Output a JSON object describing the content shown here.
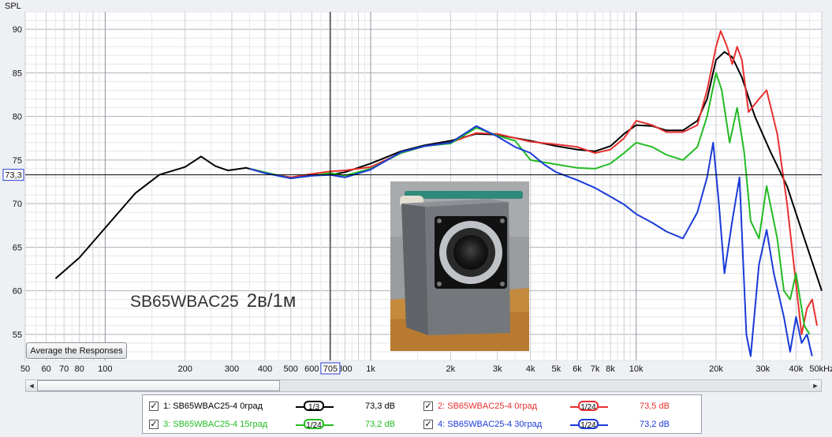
{
  "chart_data": {
    "type": "line",
    "yaxis_title": "SPL",
    "xscale": "log",
    "xlim": [
      50,
      50000
    ],
    "ylim": [
      52,
      92
    ],
    "x_ticks": [
      {
        "v": 50,
        "l": "50"
      },
      {
        "v": 60,
        "l": "60"
      },
      {
        "v": 70,
        "l": "70"
      },
      {
        "v": 80,
        "l": "80"
      },
      {
        "v": 100,
        "l": "100"
      },
      {
        "v": 200,
        "l": "200"
      },
      {
        "v": 300,
        "l": "300"
      },
      {
        "v": 400,
        "l": "400"
      },
      {
        "v": 500,
        "l": "500"
      },
      {
        "v": 600,
        "l": "600"
      },
      {
        "v": 800,
        "l": "800"
      },
      {
        "v": 1000,
        "l": "1k"
      },
      {
        "v": 2000,
        "l": "2k"
      },
      {
        "v": 3000,
        "l": "3k"
      },
      {
        "v": 4000,
        "l": "4k"
      },
      {
        "v": 5000,
        "l": "5k"
      },
      {
        "v": 6000,
        "l": "6k"
      },
      {
        "v": 7000,
        "l": "7k"
      },
      {
        "v": 8000,
        "l": "8k"
      },
      {
        "v": 10000,
        "l": "10k"
      },
      {
        "v": 20000,
        "l": "20k"
      },
      {
        "v": 30000,
        "l": "30k"
      },
      {
        "v": 40000,
        "l": "40k"
      },
      {
        "v": 50000,
        "l": "50kHz"
      }
    ],
    "y_ticks": [
      55,
      60,
      65,
      70,
      75,
      80,
      85,
      90
    ],
    "cursor": {
      "x": 705,
      "y": 73.3,
      "x_label": "705",
      "y_label": "73,3"
    },
    "grid": true,
    "series": [
      {
        "name": "1: SB65WBAC25-4 0град",
        "color": "#000000",
        "points": [
          [
            65,
            61.4
          ],
          [
            80,
            63.8
          ],
          [
            100,
            67.2
          ],
          [
            130,
            71.2
          ],
          [
            160,
            73.3
          ],
          [
            200,
            74.2
          ],
          [
            230,
            75.4
          ],
          [
            260,
            74.3
          ],
          [
            290,
            73.8
          ],
          [
            340,
            74.1
          ],
          [
            400,
            73.5
          ],
          [
            500,
            73.0
          ],
          [
            600,
            73.3
          ],
          [
            705,
            73.3
          ],
          [
            800,
            73.6
          ],
          [
            1000,
            74.6
          ],
          [
            1300,
            76.0
          ],
          [
            1600,
            76.7
          ],
          [
            2000,
            77.2
          ],
          [
            2500,
            78.0
          ],
          [
            3000,
            77.9
          ],
          [
            4000,
            77.2
          ],
          [
            5000,
            76.6
          ],
          [
            6000,
            76.2
          ],
          [
            7000,
            76.0
          ],
          [
            8000,
            76.6
          ],
          [
            9000,
            78.0
          ],
          [
            10000,
            79.0
          ],
          [
            11500,
            78.9
          ],
          [
            13000,
            78.4
          ],
          [
            15000,
            78.4
          ],
          [
            17000,
            79.5
          ],
          [
            18500,
            82.0
          ],
          [
            20000,
            86.5
          ],
          [
            21500,
            87.4
          ],
          [
            23000,
            86.8
          ],
          [
            25000,
            84.5
          ],
          [
            28000,
            80.0
          ],
          [
            32000,
            76.0
          ],
          [
            37000,
            72.0
          ],
          [
            43000,
            66.0
          ],
          [
            50000,
            60.0
          ]
        ]
      },
      {
        "name": "2: SB65WBAC25-4 0град",
        "color": "#e8302f",
        "points": [
          [
            350,
            74.0
          ],
          [
            400,
            73.5
          ],
          [
            500,
            73.0
          ],
          [
            600,
            73.4
          ],
          [
            705,
            73.7
          ],
          [
            800,
            73.8
          ],
          [
            1000,
            74.2
          ],
          [
            1300,
            75.8
          ],
          [
            1600,
            76.6
          ],
          [
            2000,
            77.0
          ],
          [
            2500,
            78.1
          ],
          [
            3000,
            78.0
          ],
          [
            4000,
            77.1
          ],
          [
            5000,
            76.8
          ],
          [
            6000,
            76.5
          ],
          [
            7000,
            75.8
          ],
          [
            8000,
            76.2
          ],
          [
            9000,
            77.5
          ],
          [
            10000,
            79.5
          ],
          [
            11500,
            79.0
          ],
          [
            13000,
            78.2
          ],
          [
            15000,
            78.2
          ],
          [
            17000,
            79.0
          ],
          [
            18500,
            83.0
          ],
          [
            20000,
            88.0
          ],
          [
            20800,
            89.8
          ],
          [
            22000,
            88.0
          ],
          [
            23000,
            86.0
          ],
          [
            24000,
            88.0
          ],
          [
            25000,
            86.5
          ],
          [
            26500,
            80.5
          ],
          [
            29000,
            82.0
          ],
          [
            31000,
            83.0
          ],
          [
            34000,
            78.0
          ],
          [
            37000,
            70.0
          ],
          [
            42000,
            55.0
          ],
          [
            44000,
            58.0
          ],
          [
            46000,
            59.0
          ],
          [
            48000,
            56.0
          ]
        ]
      },
      {
        "name": "3: SB65WBAC25-4 15град",
        "color": "#22bb22",
        "points": [
          [
            350,
            74.0
          ],
          [
            400,
            73.6
          ],
          [
            500,
            72.9
          ],
          [
            600,
            73.2
          ],
          [
            705,
            73.5
          ],
          [
            800,
            73.2
          ],
          [
            1000,
            74.0
          ],
          [
            1300,
            75.8
          ],
          [
            1600,
            76.6
          ],
          [
            2000,
            76.9
          ],
          [
            2500,
            78.7
          ],
          [
            3000,
            77.8
          ],
          [
            3500,
            77.2
          ],
          [
            4000,
            75.0
          ],
          [
            5000,
            74.5
          ],
          [
            6000,
            74.1
          ],
          [
            7000,
            74.0
          ],
          [
            8000,
            74.6
          ],
          [
            9000,
            75.8
          ],
          [
            10000,
            77.0
          ],
          [
            11500,
            76.5
          ],
          [
            13000,
            75.6
          ],
          [
            15000,
            75.0
          ],
          [
            17000,
            76.5
          ],
          [
            18500,
            80.0
          ],
          [
            20000,
            85.0
          ],
          [
            21000,
            83.0
          ],
          [
            22500,
            77.0
          ],
          [
            24000,
            81.0
          ],
          [
            25500,
            76.0
          ],
          [
            27000,
            68.0
          ],
          [
            29000,
            66.0
          ],
          [
            31000,
            72.0
          ],
          [
            34000,
            66.0
          ],
          [
            36000,
            60.0
          ],
          [
            38000,
            59.0
          ],
          [
            40000,
            62.0
          ],
          [
            43000,
            56.0
          ],
          [
            45000,
            55.0
          ]
        ]
      },
      {
        "name": "4: SB65WBAC25-4 30град",
        "color": "#1a3ad8",
        "points": [
          [
            350,
            74.0
          ],
          [
            400,
            73.5
          ],
          [
            500,
            72.9
          ],
          [
            600,
            73.2
          ],
          [
            705,
            73.3
          ],
          [
            800,
            73.0
          ],
          [
            1000,
            73.9
          ],
          [
            1300,
            75.9
          ],
          [
            1600,
            76.6
          ],
          [
            2000,
            77.0
          ],
          [
            2500,
            78.9
          ],
          [
            3000,
            77.7
          ],
          [
            3500,
            76.5
          ],
          [
            4000,
            75.8
          ],
          [
            4500,
            74.5
          ],
          [
            5000,
            73.6
          ],
          [
            6000,
            72.7
          ],
          [
            7000,
            71.8
          ],
          [
            8000,
            70.8
          ],
          [
            9000,
            69.9
          ],
          [
            10000,
            68.8
          ],
          [
            11500,
            67.8
          ],
          [
            13000,
            66.8
          ],
          [
            15000,
            66.0
          ],
          [
            17000,
            69.0
          ],
          [
            18500,
            73.0
          ],
          [
            19500,
            77.0
          ],
          [
            20500,
            70.0
          ],
          [
            21500,
            62.0
          ],
          [
            23000,
            68.0
          ],
          [
            24500,
            73.0
          ],
          [
            26000,
            55.0
          ],
          [
            27000,
            52.5
          ],
          [
            29000,
            63.0
          ],
          [
            31000,
            67.0
          ],
          [
            33000,
            62.0
          ],
          [
            36000,
            57.0
          ],
          [
            38000,
            53.0
          ],
          [
            40000,
            57.0
          ],
          [
            42000,
            54.0
          ],
          [
            44000,
            55.0
          ],
          [
            46000,
            52.5
          ]
        ]
      }
    ]
  },
  "caption": {
    "model": "SB65WBAC25",
    "setup": "2в/1м"
  },
  "buttons": {
    "average": "Average the Responses"
  },
  "scrollbar": {
    "left_arrow": "◄",
    "right_arrow": "►"
  },
  "legend": {
    "rows": [
      {
        "label": "1: SB65WBAC25-4 0град",
        "smoothing": "1/3",
        "value": "73,3 dB",
        "color": "#000000",
        "checked": "✓"
      },
      {
        "label": "2: SB65WBAC25-4 0град",
        "smoothing": "1/24",
        "value": "73,5 dB",
        "color": "#e8302f",
        "checked": "✓"
      },
      {
        "label": "3: SB65WBAC25-4 15град",
        "smoothing": "1/24",
        "value": "73,2 dB",
        "color": "#22bb22",
        "checked": "✓"
      },
      {
        "label": "4: SB65WBAC25-4 30град",
        "smoothing": "1/24",
        "value": "73,2 dB",
        "color": "#1a3ad8",
        "checked": "✓"
      }
    ]
  }
}
